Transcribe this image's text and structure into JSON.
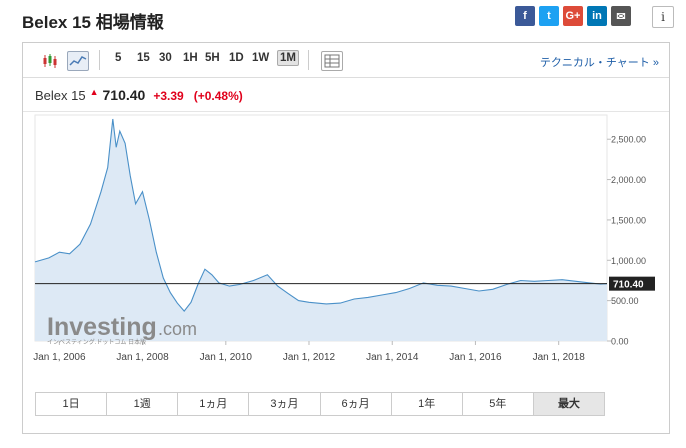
{
  "page": {
    "title": "Belex 15 相場情報"
  },
  "share": {
    "buttons": [
      {
        "name": "facebook-icon",
        "glyph": "f",
        "color": "#3b5998"
      },
      {
        "name": "twitter-icon",
        "glyph": "t",
        "color": "#1da1f2"
      },
      {
        "name": "google-plus-icon",
        "glyph": "G+",
        "color": "#dd4b39"
      },
      {
        "name": "linkedin-icon",
        "glyph": "in",
        "color": "#0077b5"
      },
      {
        "name": "email-icon",
        "glyph": "✉",
        "color": "#555555"
      }
    ],
    "info_glyph": "i"
  },
  "toolbar": {
    "periods": [
      "5",
      "15",
      "30",
      "1H",
      "5H",
      "1D",
      "1W",
      "1M"
    ],
    "active_period": "1M",
    "tech_link": "テクニカル・チャート »"
  },
  "quote": {
    "symbol": "Belex 15",
    "price": "710.40",
    "change": "+3.39",
    "change_pct": "(+0.48%)"
  },
  "watermark": {
    "brand": "Investing",
    "suffix": ".com",
    "tagline": "インベスティング.ドットコム 日本版"
  },
  "ranges": [
    "1日",
    "1週",
    "1ヵ月",
    "3ヵ月",
    "6ヵ月",
    "1年",
    "5年",
    "最大"
  ],
  "active_range": "最大",
  "colors": {
    "line": "#4a90c8",
    "fill": "#dde9f5",
    "up": "#e0001b",
    "price_tag": "#222222"
  },
  "chart_data": {
    "type": "area",
    "x_ticks": [
      "Jan 1, 2006",
      "Jan 1, 2008",
      "Jan 1, 2010",
      "Jan 1, 2012",
      "Jan 1, 2014",
      "Jan 1, 2016",
      "Jan 1, 2018"
    ],
    "y_ticks": [
      "2,500.00",
      "2,000.00",
      "1,500.00",
      "1,000.00",
      "500.00",
      "0.00"
    ],
    "ylim": [
      0,
      2800
    ],
    "xlim": [
      "2005-06-01",
      "2019-03-01"
    ],
    "last_value_label": "710.40",
    "last_value": 710.4,
    "grid": false,
    "series": [
      {
        "x": [
          "2005-06-01",
          "2005-10-01",
          "2006-01-01",
          "2006-04-01",
          "2006-07-01",
          "2006-10-01",
          "2007-01-01",
          "2007-03-01",
          "2007-04-15",
          "2007-05-15",
          "2007-06-15",
          "2007-08-01",
          "2007-09-15",
          "2007-11-01",
          "2008-01-01",
          "2008-03-01",
          "2008-05-01",
          "2008-07-01",
          "2008-09-01",
          "2008-11-01",
          "2009-01-01",
          "2009-03-01",
          "2009-05-01",
          "2009-07-01",
          "2009-09-01",
          "2009-11-01",
          "2010-02-01",
          "2010-05-01",
          "2010-09-01",
          "2011-01-01",
          "2011-04-01",
          "2011-07-01",
          "2011-10-01",
          "2012-01-01",
          "2012-06-01",
          "2012-10-01",
          "2013-02-01",
          "2013-06-01",
          "2013-10-01",
          "2014-02-01",
          "2014-06-01",
          "2014-10-01",
          "2015-02-01",
          "2015-06-01",
          "2015-10-01",
          "2016-02-01",
          "2016-06-01",
          "2016-10-01",
          "2017-02-01",
          "2017-06-01",
          "2017-10-01",
          "2018-02-01",
          "2018-06-01",
          "2018-10-01",
          "2019-01-01",
          "2019-03-01"
        ],
        "values": [
          980,
          1030,
          1100,
          1080,
          1200,
          1450,
          1850,
          2150,
          2750,
          2400,
          2600,
          2450,
          2050,
          1700,
          1850,
          1500,
          1100,
          780,
          600,
          470,
          370,
          480,
          700,
          890,
          820,
          720,
          680,
          700,
          750,
          820,
          680,
          590,
          500,
          480,
          460,
          470,
          520,
          540,
          570,
          600,
          650,
          720,
          690,
          680,
          650,
          620,
          640,
          700,
          750,
          740,
          750,
          760,
          740,
          720,
          705,
          710.4
        ]
      }
    ]
  }
}
